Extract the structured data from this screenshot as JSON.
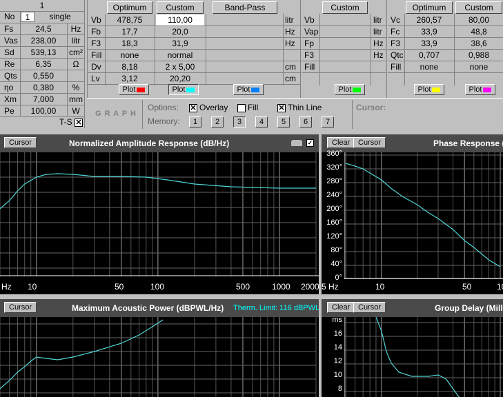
{
  "ts": {
    "header": "1",
    "no_label": "No",
    "no_value": "1",
    "mode": "single",
    "rows": [
      {
        "name": "Fs",
        "value": "24,5",
        "unit": "Hz"
      },
      {
        "name": "Vas",
        "value": "238,00",
        "unit": "litr"
      },
      {
        "name": "Sd",
        "value": "539,13",
        "unit": "cm²"
      },
      {
        "name": "Re",
        "value": "6,35",
        "unit": "Ω"
      },
      {
        "name": "Qts",
        "value": "0,550",
        "unit": ""
      },
      {
        "name": "ηo",
        "value": "0,380",
        "unit": "%"
      },
      {
        "name": "Xm",
        "value": "7,000",
        "unit": "mm"
      },
      {
        "name": "Pe",
        "value": "100,00",
        "unit": "W"
      }
    ],
    "ts_label": "T-S",
    "ts_checked": "✕"
  },
  "closed": {
    "col1": "Optimum",
    "col2": "Custom",
    "rows": [
      {
        "name": "Vb",
        "opt": "478,75",
        "cust": "110,00",
        "unit": "litr"
      },
      {
        "name": "Fb",
        "opt": "17,7",
        "cust": "20,0",
        "unit": "Hz"
      },
      {
        "name": "F3",
        "opt": "18,3",
        "cust": "31,9",
        "unit": "Hz"
      },
      {
        "name": "Fill",
        "opt": "none",
        "cust": "normal",
        "unit": ""
      },
      {
        "name": "Dv",
        "opt": "8,18",
        "cust": "2 x 5,00",
        "unit": "cm"
      },
      {
        "name": "Lv",
        "opt": "3,12",
        "cust": "20,20",
        "unit": "cm"
      }
    ],
    "plot": "Plot"
  },
  "bandpass": {
    "label": "Band-Pass",
    "plot": "Plot",
    "units": [
      "litr",
      "Hz",
      "Hz",
      "",
      "cm",
      "cm"
    ]
  },
  "passive": {
    "col": "Custom",
    "rows": [
      {
        "name": "Vb",
        "unit": "litr"
      },
      {
        "name": "Vap",
        "unit": "litr"
      },
      {
        "name": "Fp",
        "unit": "Hz"
      },
      {
        "name": "F3",
        "unit": "Hz"
      },
      {
        "name": "Fill",
        "unit": ""
      }
    ],
    "plot": "Plot"
  },
  "sealed": {
    "col1": "Optimum",
    "col2": "Custom",
    "rows": [
      {
        "name": "Vc",
        "opt": "260,57",
        "cust": "80,00"
      },
      {
        "name": "Fc",
        "opt": "33,9",
        "cust": "48,8"
      },
      {
        "name": "F3",
        "opt": "33,9",
        "cust": "38,6"
      },
      {
        "name": "Qtc",
        "opt": "0,707",
        "cust": "0,988"
      },
      {
        "name": "Fill",
        "opt": "none",
        "cust": "none"
      }
    ],
    "plot": "Plot"
  },
  "colors": {
    "red": "#ff0000",
    "cyan": "#00ffff",
    "blue": "#0080ff",
    "green": "#00ff00",
    "yellow": "#ffff00",
    "magenta": "#ff00ff",
    "trace": "#4fd6d6"
  },
  "graphbar": {
    "title": "G R A P H",
    "options_label": "Options:",
    "overlay": "Overlay",
    "fill": "Fill",
    "thin": "Thin Line",
    "memory_label": "Memory:",
    "memory": [
      "1",
      "2",
      "3",
      "4",
      "5",
      "6",
      "7"
    ],
    "cursor_label": "Cursor:"
  },
  "graphs": {
    "amp": {
      "title": "Normalized Amplitude Response (dB/Hz)",
      "cursor": "Cursor",
      "xticks": [
        "Hz",
        "10",
        "50",
        "100",
        "500",
        "1000",
        "2000"
      ]
    },
    "phase": {
      "title": "Phase Response (",
      "clear": "Clear",
      "cursor": "Cursor",
      "yticks": [
        "360°",
        "320°",
        "280°",
        "240°",
        "200°",
        "160°",
        "120°",
        "80°",
        "40°",
        "0°"
      ],
      "xticks": [
        "5 Hz",
        "10",
        "50",
        "10"
      ]
    },
    "power": {
      "title": "Maximum Acoustic Power (dBPWL/Hz)",
      "cursor": "Cursor",
      "therm": "Therm. Limit: 116 dBPWL"
    },
    "delay": {
      "title": "Group Delay (Milli",
      "clear": "Clear",
      "cursor": "Cursor",
      "yticks": [
        "ms",
        "16",
        "14",
        "12",
        "10",
        "8"
      ]
    }
  },
  "chart_data": [
    {
      "type": "line",
      "title": "Normalized Amplitude Response (dB/Hz)",
      "x": [
        10,
        20,
        30,
        50,
        100,
        200,
        500,
        2000
      ]
    },
    {
      "type": "line",
      "title": "Phase Response",
      "y_unit": "degrees",
      "x": [
        5,
        10,
        20,
        50,
        100
      ],
      "y": [
        330,
        300,
        240,
        150,
        40
      ],
      "ylim": [
        0,
        360
      ]
    },
    {
      "type": "line",
      "title": "Maximum Acoustic Power (dBPWL/Hz)"
    },
    {
      "type": "line",
      "title": "Group Delay",
      "y_unit": "ms",
      "ylim": [
        8,
        16
      ]
    }
  ]
}
